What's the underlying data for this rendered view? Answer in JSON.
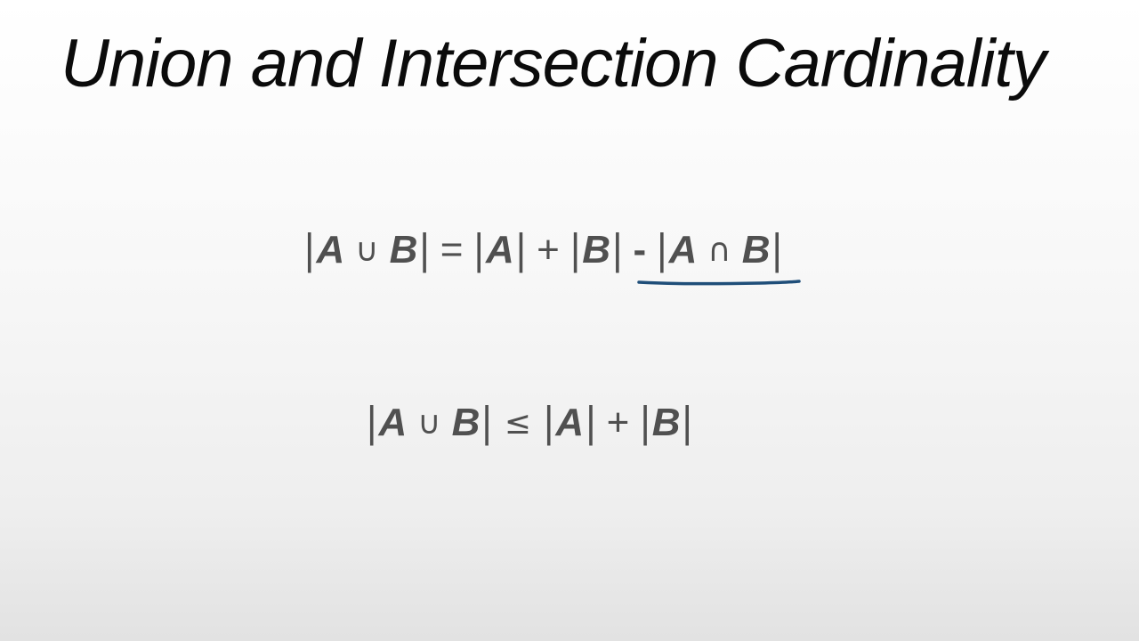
{
  "slide": {
    "title": "Union and Intersection Cardinality",
    "formula1": {
      "bar": "|",
      "a": "A",
      "b": "B",
      "union": "∪",
      "intersect": "∩",
      "equals": "=",
      "plus": "+",
      "minus": "-"
    },
    "formula2": {
      "bar": "|",
      "a": "A",
      "b": "B",
      "union": "∪",
      "leq": "≤",
      "plus": "+"
    },
    "colors": {
      "title": "#0b0b0b",
      "formula": "#505050",
      "underline": "#1f4e79"
    }
  }
}
